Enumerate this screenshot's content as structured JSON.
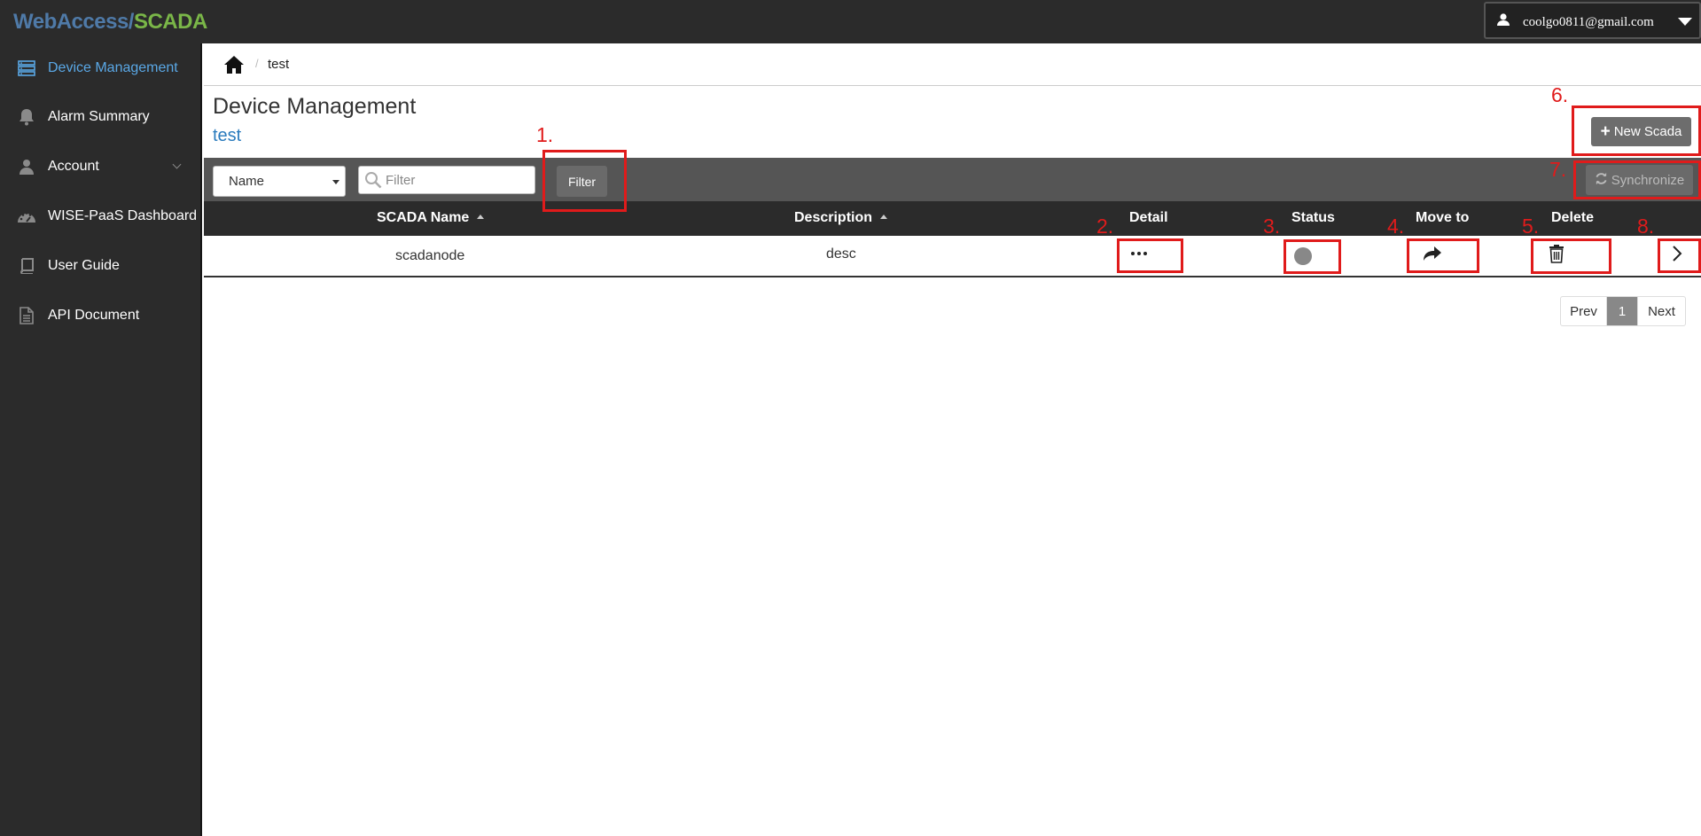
{
  "brand": {
    "part1": "WebAccess/",
    "part2": "SCADA"
  },
  "user": {
    "email": "coolgo0811@gmail.com"
  },
  "sidebar": {
    "items": [
      {
        "label": "Device Management",
        "icon": "server-icon",
        "active": true
      },
      {
        "label": "Alarm Summary",
        "icon": "bell-icon"
      },
      {
        "label": "Account",
        "icon": "user-icon"
      },
      {
        "label": "WISE-PaaS Dashboard",
        "icon": "dashboard-icon"
      },
      {
        "label": "User Guide",
        "icon": "book-icon"
      },
      {
        "label": "API Document",
        "icon": "document-icon"
      }
    ]
  },
  "breadcrumb": {
    "current": "test"
  },
  "page": {
    "title": "Device Management",
    "subtitle": "test"
  },
  "toolbar": {
    "select_value": "Name",
    "filter_placeholder": "Filter",
    "filter_button": "Filter",
    "new_button": "New Scada",
    "sync_button": "Synchronize"
  },
  "table": {
    "headers": [
      "SCADA Name",
      "Description",
      "Detail",
      "Status",
      "Move to",
      "Delete"
    ],
    "rows": [
      {
        "name": "scadanode",
        "description": "desc"
      }
    ]
  },
  "pagination": {
    "prev": "Prev",
    "current": "1",
    "next": "Next"
  },
  "annotations": [
    "1.",
    "2.",
    "3.",
    "4.",
    "5.",
    "6.",
    "7.",
    "8."
  ],
  "colors": {
    "annotation": "#e01b1b",
    "sidebar_bg": "#2b2b2b",
    "active": "#5aa8e6",
    "subtitle": "#2a7bbd"
  }
}
